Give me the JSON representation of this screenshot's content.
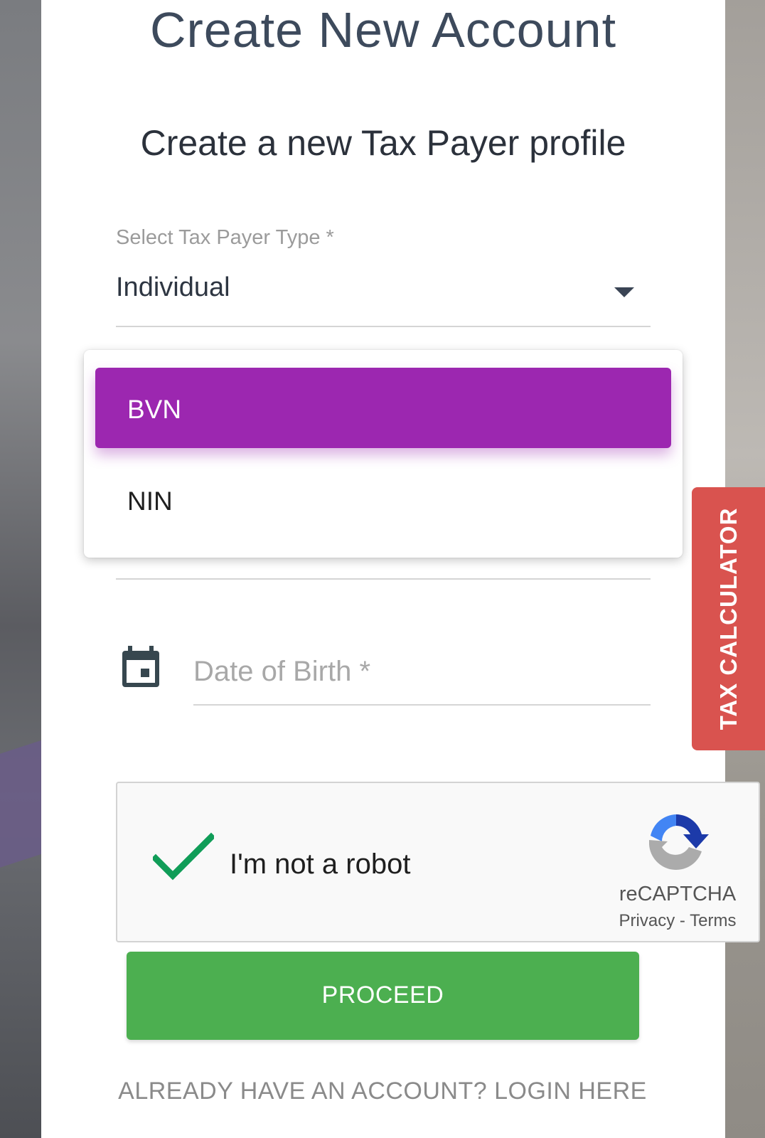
{
  "header": {
    "title": "Create New Account",
    "subtitle": "Create a new Tax Payer profile"
  },
  "taxpayer_select": {
    "label": "Select Tax Payer Type *",
    "value": "Individual"
  },
  "id_dropdown": {
    "options": [
      {
        "label": "BVN",
        "selected": true
      },
      {
        "label": "NIN",
        "selected": false
      }
    ],
    "highlight_color": "#9c27b0"
  },
  "dob_field": {
    "placeholder": "Date of Birth *"
  },
  "side_tab": {
    "label": "TAX CALCULATOR",
    "color": "#d9534f"
  },
  "recaptcha": {
    "checkbox_label": "I'm not a robot",
    "brand": "reCAPTCHA",
    "privacy": "Privacy",
    "separator": "-",
    "terms": "Terms",
    "checked": true
  },
  "actions": {
    "proceed_label": "PROCEED",
    "proceed_color": "#4caf50",
    "login_link": "ALREADY HAVE AN ACCOUNT? LOGIN HERE"
  }
}
